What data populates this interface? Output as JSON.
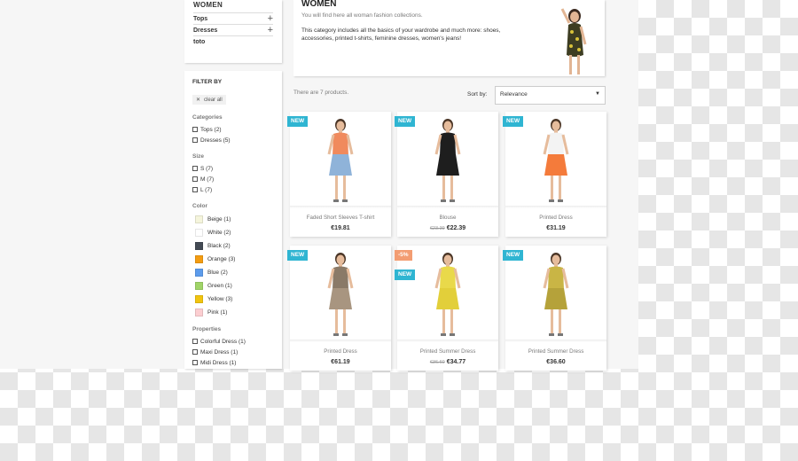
{
  "category_tree": {
    "title": "WOMEN",
    "items": [
      {
        "label": "Tops",
        "expandable": true
      },
      {
        "label": "Dresses",
        "expandable": true
      },
      {
        "label": "toto",
        "expandable": false
      }
    ]
  },
  "filters": {
    "heading": "FILTER BY",
    "clear_all": "clear all",
    "categories": {
      "title": "Categories",
      "options": [
        "Tops (2)",
        "Dresses (5)"
      ]
    },
    "size": {
      "title": "Size",
      "options": [
        "S (7)",
        "M (7)",
        "L (7)"
      ]
    },
    "color": {
      "title": "Color",
      "options": [
        {
          "label": "Beige (1)",
          "hex": "#f5f5dc"
        },
        {
          "label": "White (2)",
          "hex": "#ffffff"
        },
        {
          "label": "Black (2)",
          "hex": "#434a54"
        },
        {
          "label": "Orange (3)",
          "hex": "#f39c11"
        },
        {
          "label": "Blue (2)",
          "hex": "#5d9cec"
        },
        {
          "label": "Green (1)",
          "hex": "#a0d468"
        },
        {
          "label": "Yellow (3)",
          "hex": "#f1c40f"
        },
        {
          "label": "Pink (1)",
          "hex": "#fcced1"
        }
      ]
    },
    "properties": {
      "title": "Properties",
      "options": [
        "Colorful Dress (1)",
        "Maxi Dress (1)",
        "Midi Dress (1)"
      ]
    }
  },
  "header": {
    "title": "WOMEN",
    "subtitle": "You will find here all woman fashion collections.",
    "description": "This category includes all the basics of your wardrobe and much more: shoes, accessories, printed t-shirts, feminine dresses, women's jeans!"
  },
  "listing": {
    "count_text": "There are 7 products.",
    "sort_label": "Sort by:",
    "sort_value": "Relevance"
  },
  "products": [
    {
      "name": "Faded Short Sleeves T-shirt",
      "price": "€19.81",
      "regular_price": "",
      "flags": [
        "NEW"
      ],
      "top": "#f08a5d",
      "bottom": "#8fb3d9"
    },
    {
      "name": "Blouse",
      "price": "€22.39",
      "regular_price": "€23.39",
      "flags": [
        "NEW"
      ],
      "top": "#1e1e1e",
      "bottom": "#1e1e1e"
    },
    {
      "name": "Printed Dress",
      "price": "€31.19",
      "regular_price": "",
      "flags": [
        "NEW"
      ],
      "top": "#f3f3f3",
      "bottom": "#f47b3b"
    },
    {
      "name": "Printed Dress",
      "price": "€61.19",
      "regular_price": "",
      "flags": [
        "NEW"
      ],
      "top": "#8a7a68",
      "bottom": "#a89580"
    },
    {
      "name": "Printed Summer Dress",
      "price": "€34.77",
      "regular_price": "€36.60",
      "flags": [
        "-5%",
        "NEW"
      ],
      "top": "#e9d94a",
      "bottom": "#e2cf3a"
    },
    {
      "name": "Printed Summer Dress",
      "price": "€36.60",
      "regular_price": "",
      "flags": [
        "NEW"
      ],
      "top": "#c9b545",
      "bottom": "#b5a23a"
    }
  ]
}
